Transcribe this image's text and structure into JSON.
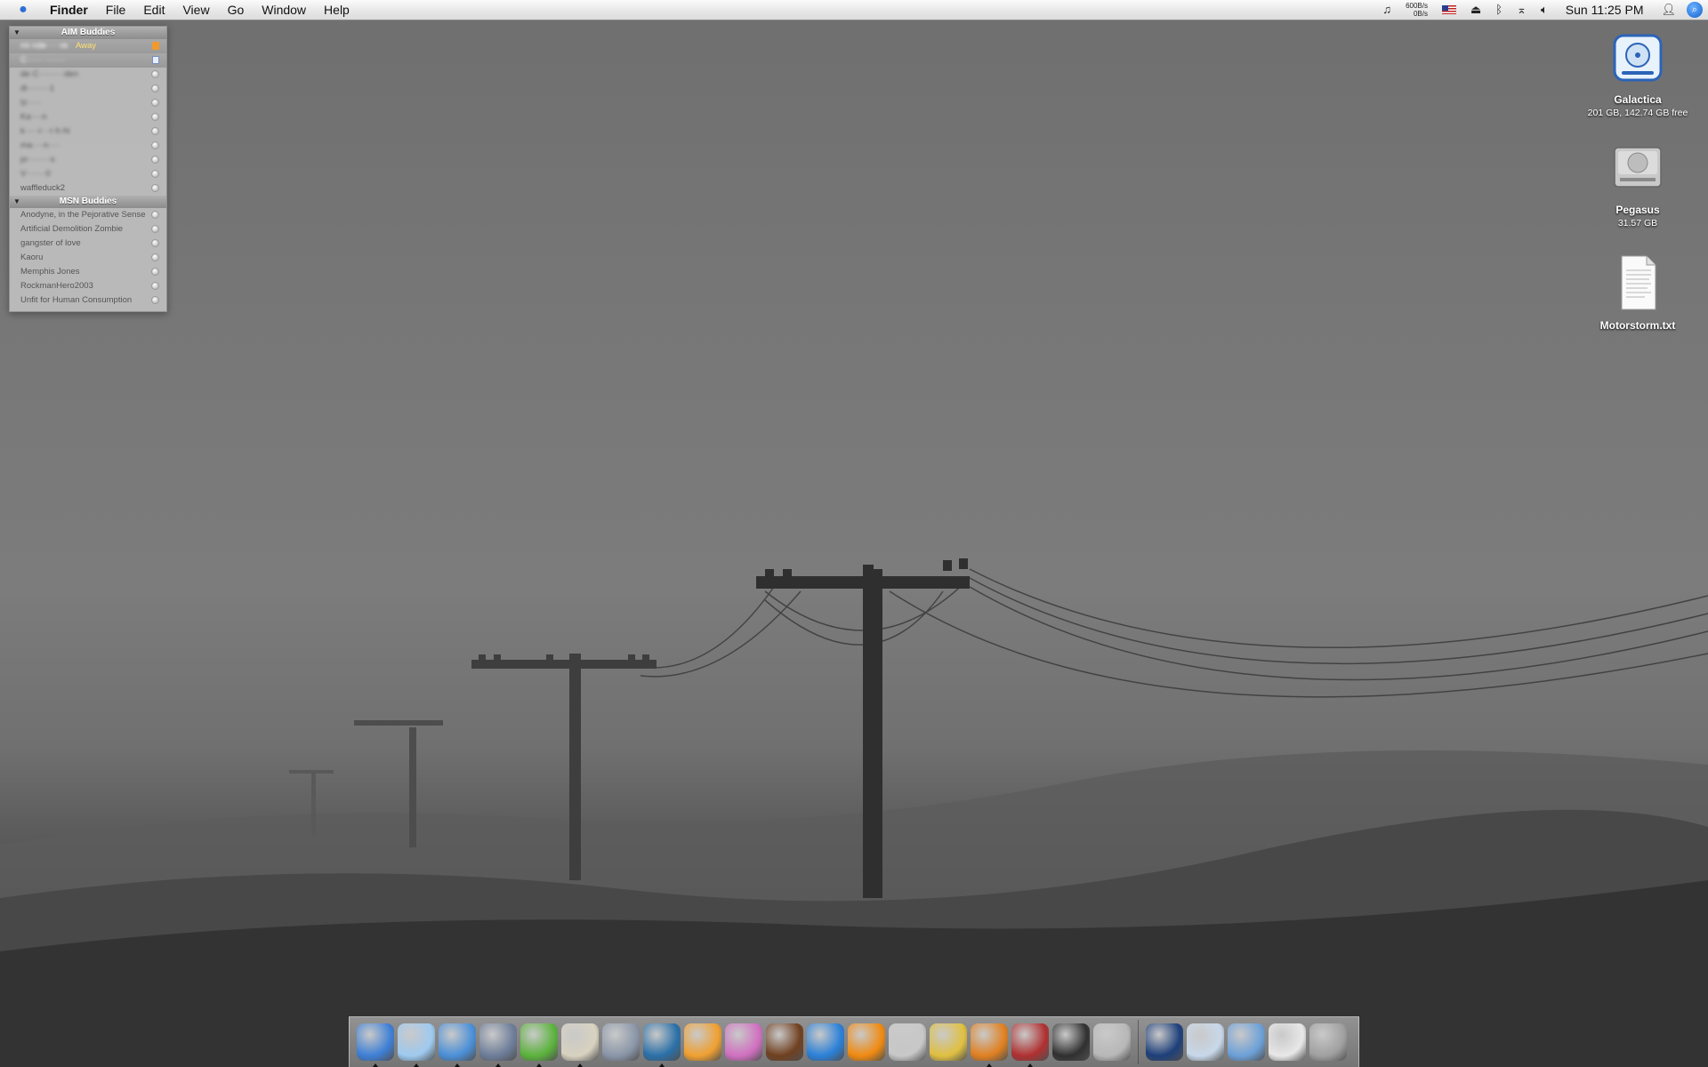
{
  "menubar": {
    "apple_icon": "apple-logo-icon",
    "app_name": "Finder",
    "menus": [
      "File",
      "Edit",
      "View",
      "Go",
      "Window",
      "Help"
    ],
    "netspeed_up": "600B/s",
    "netspeed_down": "0B/s",
    "clock": "Sun 11:25 PM"
  },
  "buddy_list": {
    "aim_group": "AIM Buddies",
    "aim_buddies": [
      {
        "name": "mi·nde·····re",
        "status": "Away",
        "selected": true
      },
      {
        "name": "C······ ·······",
        "selected": true
      },
      {
        "name": "de·C·········den"
      },
      {
        "name": "di········1"
      },
      {
        "name": "tz·····"
      },
      {
        "name": "Ka····n"
      },
      {
        "name": "k·····r···r·h·hi"
      },
      {
        "name": "ma····n····"
      },
      {
        "name": "pr········s"
      },
      {
        "name": "V·······0"
      },
      {
        "name": "waffleduck2"
      }
    ],
    "msn_group": "MSN Buddies",
    "msn_buddies": [
      {
        "name": "Anodyne, in the Pejorative Sense"
      },
      {
        "name": "Artificial Demolition Zombie"
      },
      {
        "name": "gangster of love"
      },
      {
        "name": "Kaoru"
      },
      {
        "name": "Memphis Jones"
      },
      {
        "name": "RockmanHero2003"
      },
      {
        "name": "Unfit for Human Consumption"
      }
    ]
  },
  "desktop_icons": {
    "galactica": {
      "label": "Galactica",
      "sub": "201 GB, 142.74 GB free"
    },
    "pegasus": {
      "label": "Pegasus",
      "sub": "31.57 GB"
    },
    "motorstorm": {
      "label": "Motorstorm.txt"
    }
  },
  "dock": {
    "apps": [
      {
        "name": "finder-icon",
        "color": "#3d7fd6",
        "running": true
      },
      {
        "name": "itunes-icon",
        "color": "#9ecaf0",
        "running": true
      },
      {
        "name": "safari-icon",
        "color": "#4a8fd8",
        "running": true
      },
      {
        "name": "mail-icon",
        "color": "#6d7d99",
        "running": true
      },
      {
        "name": "adium-icon",
        "color": "#5bb33c",
        "running": true
      },
      {
        "name": "textedit-icon",
        "color": "#d8d2c0",
        "running": true
      },
      {
        "name": "preview-icon",
        "color": "#8a96a8",
        "running": false
      },
      {
        "name": "quill-icon",
        "color": "#2a70a8",
        "running": true
      },
      {
        "name": "iphoto-icon",
        "color": "#f0a030",
        "running": false
      },
      {
        "name": "butterfly-icon",
        "color": "#d070c0",
        "running": false
      },
      {
        "name": "photobooth-icon",
        "color": "#704020",
        "running": false
      },
      {
        "name": "quicktime-icon",
        "color": "#2a80d8",
        "running": false
      },
      {
        "name": "vlc-icon",
        "color": "#f08a10",
        "running": false
      },
      {
        "name": "toaster-icon",
        "color": "#c8c8c8",
        "running": false
      },
      {
        "name": "transmit-icon",
        "color": "#e0c040",
        "running": false
      },
      {
        "name": "zeal-icon",
        "color": "#e08020",
        "running": true
      },
      {
        "name": "dictionary-icon",
        "color": "#b03030",
        "running": true
      },
      {
        "name": "activity-monitor-icon",
        "color": "#303030",
        "running": false
      },
      {
        "name": "system-prefs-icon",
        "color": "#b8b8b8",
        "running": false
      }
    ],
    "docs": [
      {
        "name": "applications-stack-icon",
        "color": "#1d3f7a"
      },
      {
        "name": "spreadsheet-stack-icon",
        "color": "#c8d8ea"
      },
      {
        "name": "downloads-folder-icon",
        "color": "#6ca0d8"
      },
      {
        "name": "documents-stack-icon",
        "color": "#e8e8e8"
      },
      {
        "name": "trash-icon",
        "color": "#a0a0a0"
      }
    ]
  }
}
